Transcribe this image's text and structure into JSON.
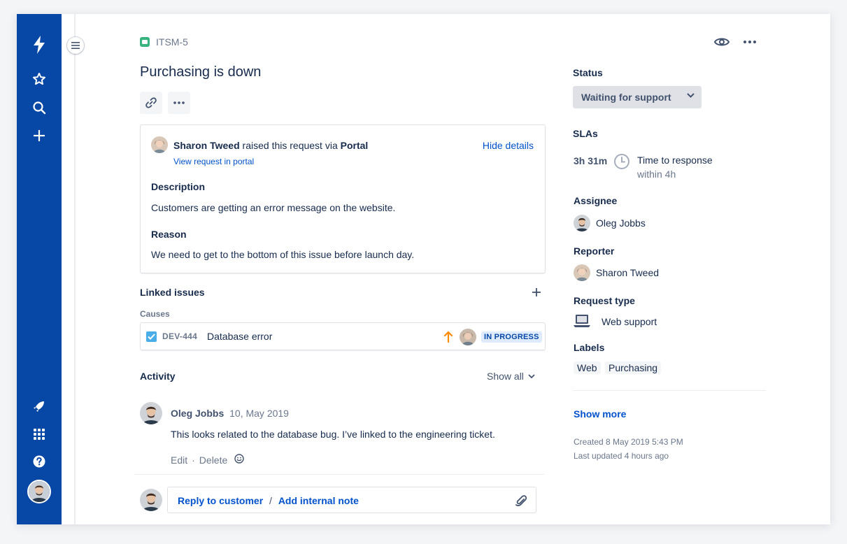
{
  "colors": {
    "nav": "#0747a6",
    "accent": "#0052cc",
    "text": "#172b4d",
    "muted": "#6b778c",
    "lozenge_bg": "#deebff",
    "priority": "#ff8b00",
    "issue_type": "#36b37e"
  },
  "nav": {
    "icons": [
      "lightning-logo-icon",
      "star-icon",
      "search-icon",
      "plus-icon",
      "rocket-icon",
      "app-grid-icon",
      "help-icon",
      "avatar"
    ]
  },
  "issue": {
    "key": "ITSM-5",
    "title": "Purchasing is down"
  },
  "request": {
    "raiser": "Sharon Tweed",
    "raised_text": "raised this request via",
    "channel": "Portal",
    "view_portal": "View request in portal",
    "hide_details": "Hide details",
    "description_label": "Description",
    "description": "Customers are getting an error message on the website.",
    "reason_label": "Reason",
    "reason": "We need to get to the bottom of this issue before launch day."
  },
  "linked": {
    "title": "Linked issues",
    "relation": "Causes",
    "item": {
      "key": "DEV-444",
      "summary": "Database error",
      "status": "IN PROGRESS"
    }
  },
  "activity": {
    "title": "Activity",
    "show_all": "Show all",
    "comment": {
      "author": "Oleg Jobbs",
      "date": "10, May 2019",
      "text": "This looks related to the database bug. I’ve linked to the engineering ticket.",
      "edit": "Edit",
      "delete": "Delete",
      "sep": "·"
    },
    "reply_customer": "Reply to customer",
    "reply_sep": "/",
    "add_note": "Add internal note"
  },
  "side": {
    "status_label": "Status",
    "status_value": "Waiting for support",
    "slas_label": "SLAs",
    "sla_time": "3h 31m",
    "sla_name": "Time to response",
    "sla_within": "within 4h",
    "assignee_label": "Assignee",
    "assignee": "Oleg Jobbs",
    "reporter_label": "Reporter",
    "reporter": "Sharon Tweed",
    "request_type_label": "Request type",
    "request_type": "Web support",
    "labels_label": "Labels",
    "labels": [
      "Web",
      "Purchasing"
    ],
    "show_more": "Show more",
    "created": "Created 8 May 2019 5:43 PM",
    "updated": "Last updated 4 hours ago"
  }
}
